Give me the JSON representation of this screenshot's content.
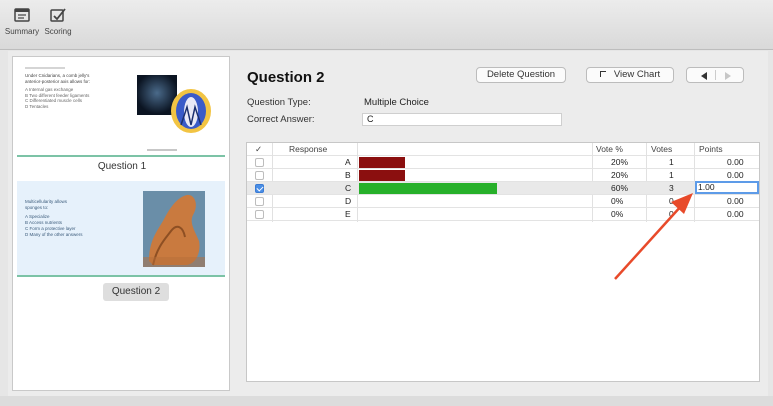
{
  "toolbar": {
    "items": [
      {
        "label": "Summary",
        "icon": "summary-icon"
      },
      {
        "label": "Scoring",
        "icon": "scoring-icon"
      }
    ]
  },
  "slides": [
    {
      "caption": "Question 1",
      "heading": "Under Cnidarians, a comb jelly's",
      "subheading": "anterior-posterior axis allows for:",
      "options": [
        "A  Internal gas exchange",
        "B  Two different feeder ligaments",
        "C  Differentiated muscle cells",
        "D  Tentacles"
      ]
    },
    {
      "caption": "Question 2",
      "heading": "Multicellularity allows",
      "subheading": "sponges to:",
      "options": [
        "A  Specialize",
        "B  Access nutrients",
        "C  Form a protective layer",
        "D  Many of the other answers"
      ]
    }
  ],
  "question": {
    "title": "Question 2",
    "type_label": "Question Type:",
    "type_value": "Multiple Choice",
    "answer_label": "Correct Answer:",
    "answer_value": "C",
    "delete_label": "Delete Question",
    "chart_label": "View Chart",
    "chart_icon": "chart-icon",
    "prev_icon": "prev-arrow-icon",
    "next_icon": "next-arrow-icon"
  },
  "table": {
    "headers": {
      "check": "✓",
      "response": "Response",
      "vote_pct": "Vote %",
      "votes": "Votes",
      "points": "Points"
    },
    "rows": [
      {
        "letter": "A",
        "vote_pct": "20%",
        "votes": "1",
        "points": "0.00",
        "checked": false,
        "bar_color": "#8b0f0f",
        "bar_fraction": 0.2
      },
      {
        "letter": "B",
        "vote_pct": "20%",
        "votes": "1",
        "points": "0.00",
        "checked": false,
        "bar_color": "#8b0f0f",
        "bar_fraction": 0.2
      },
      {
        "letter": "C",
        "vote_pct": "60%",
        "votes": "3",
        "points": "1.00",
        "checked": true,
        "bar_color": "#27b02a",
        "bar_fraction": 0.6
      },
      {
        "letter": "D",
        "vote_pct": "0%",
        "votes": "0",
        "points": "0.00",
        "checked": false,
        "bar_color": "",
        "bar_fraction": 0
      },
      {
        "letter": "E",
        "vote_pct": "0%",
        "votes": "0",
        "points": "0.00",
        "checked": false,
        "bar_color": "",
        "bar_fraction": 0
      }
    ]
  },
  "annotation": {
    "arrow_color": "#e84a2a"
  }
}
